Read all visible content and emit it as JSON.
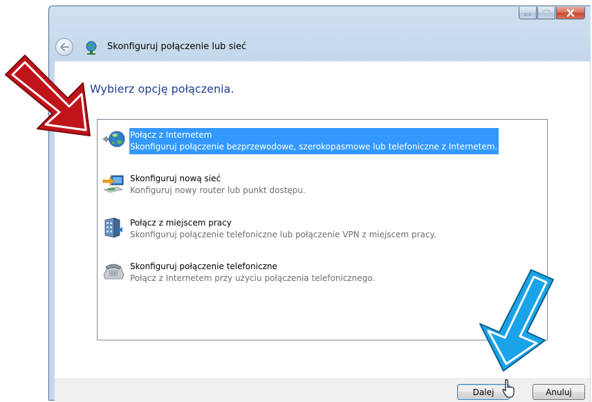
{
  "window": {
    "title": "Skonfiguruj połączenie lub sieć",
    "caption_buttons": [
      "minimize-icon",
      "maximize-icon",
      "close-icon"
    ]
  },
  "main": {
    "heading": "Wybierz opcję połączenia.",
    "options": [
      {
        "title": "Połącz z Internetem",
        "description": "Skonfiguruj połączenie bezprzewodowe, szerokopasmowe lub telefoniczne z Internetem.",
        "icon": "globe-icon",
        "selected": true
      },
      {
        "title": "Skonfiguruj nową sieć",
        "description": "Konfiguruj nowy router lub punkt dostępu.",
        "icon": "network-setup-icon",
        "selected": false
      },
      {
        "title": "Połącz z miejscem pracy",
        "description": "Skonfiguruj połączenie telefoniczne lub połączenie VPN z miejscem pracy.",
        "icon": "workplace-icon",
        "selected": false
      },
      {
        "title": "Skonfiguruj połączenie telefoniczne",
        "description": "Połącz z Internetem przy użyciu połączenia telefonicznego.",
        "icon": "telephone-icon",
        "selected": false
      }
    ]
  },
  "footer": {
    "next_label": "Dalej",
    "cancel_label": "Anuluj"
  },
  "colors": {
    "selection": "#3399ff",
    "heading": "#1c3f94",
    "red_arrow": "#c0141b",
    "blue_arrow": "#1aa3e8"
  }
}
